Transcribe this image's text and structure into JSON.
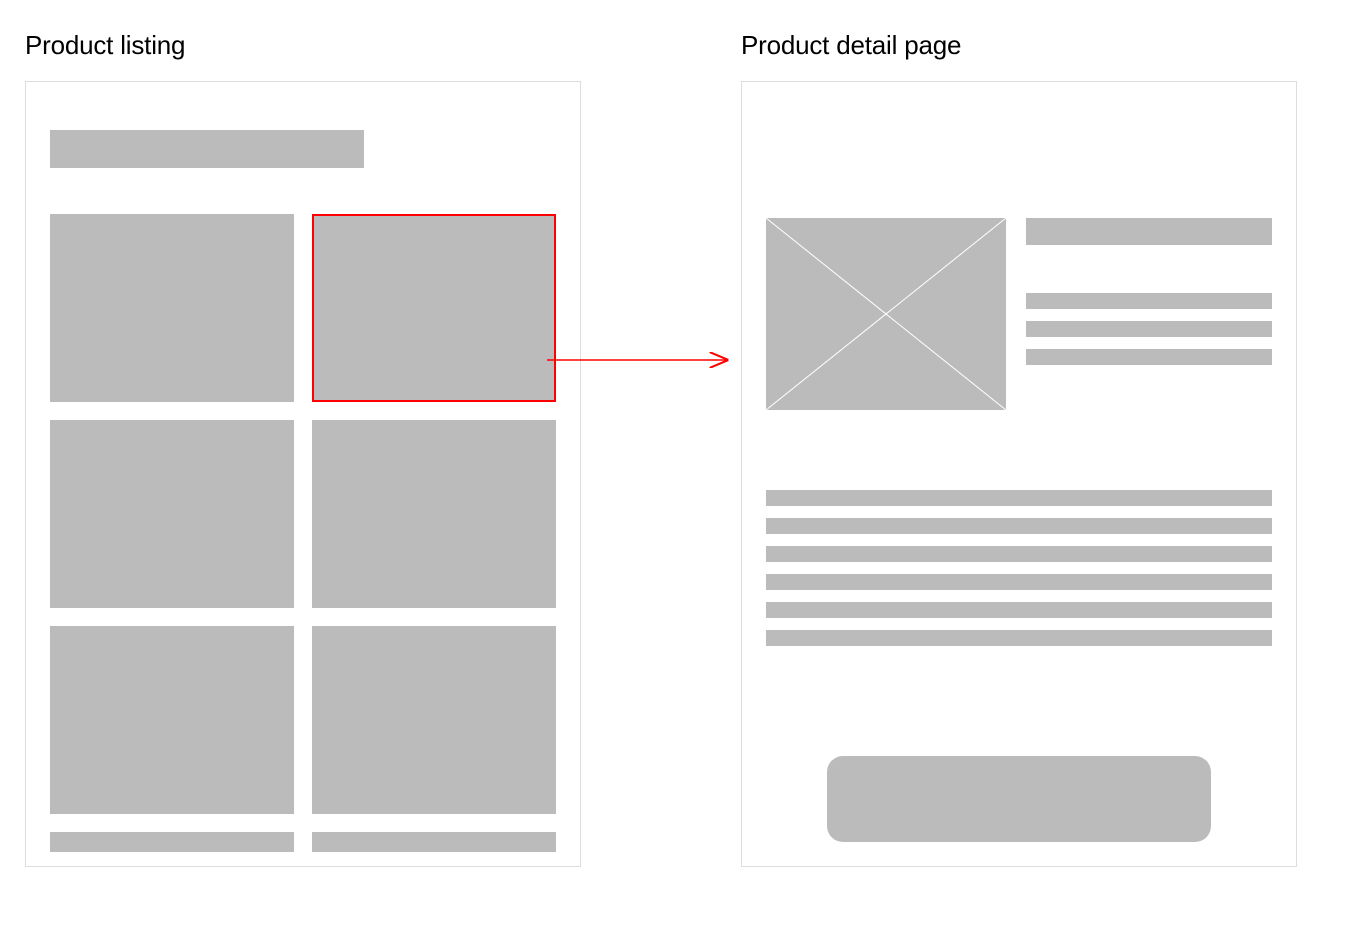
{
  "left": {
    "title": "Product listing"
  },
  "right": {
    "title": "Product detail page"
  },
  "colors": {
    "placeholder": "#bbbbbb",
    "highlight": "#ff0000",
    "panel_border": "#dddddd"
  }
}
